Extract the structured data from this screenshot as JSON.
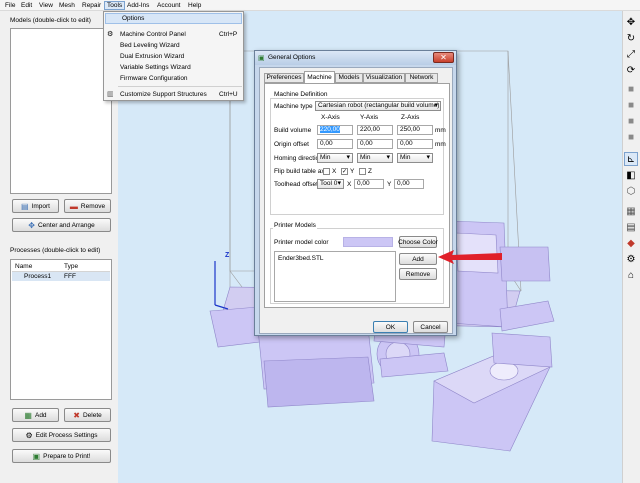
{
  "menubar": {
    "file": "File",
    "edit": "Edit",
    "view": "View",
    "mesh": "Mesh",
    "repair": "Repair",
    "tools": "Tools",
    "addins": "Add-Ins",
    "account": "Account",
    "help": "Help"
  },
  "tools_menu": {
    "options": "Options",
    "machine_control": "Machine Control Panel",
    "machine_control_shortcut": "Ctrl+P",
    "bed_leveling": "Bed Leveling Wizard",
    "dual_extrusion": "Dual Extrusion Wizard",
    "variable_settings": "Variable Settings Wizard",
    "firmware": "Firmware Configuration",
    "support": "Customize Support Structures",
    "support_shortcut": "Ctrl+U"
  },
  "left": {
    "models_title": "Models (double-click to edit)",
    "import": "Import",
    "remove": "Remove",
    "center": "Center and Arrange",
    "processes_title": "Processes (double-click to edit)",
    "col_name": "Name",
    "col_type": "Type",
    "process_name": "Process1",
    "process_type": "FFF",
    "add": "Add",
    "delete": "Delete",
    "edit_process": "Edit Process Settings",
    "prepare": "Prepare to Print!"
  },
  "viewport": {
    "axis_z": "Z"
  },
  "dialog": {
    "title": "General Options",
    "tabs": [
      "Preferences",
      "Machine",
      "Models",
      "Visualization",
      "Network"
    ],
    "machine_def": "Machine Definition",
    "machine_type_label": "Machine type",
    "machine_type_value": "Cartesian robot (rectangular build volume)",
    "x_axis": "X-Axis",
    "y_axis": "Y-Axis",
    "z_axis": "Z-Axis",
    "build_volume": "Build volume",
    "bv_x": "220,00",
    "bv_y": "220,00",
    "bv_z": "250,00",
    "origin_offset": "Origin offset",
    "oo_x": "0,00",
    "oo_y": "0,00",
    "oo_z": "0,00",
    "mm": "mm",
    "homing": "Homing direction",
    "home_x": "Min",
    "home_y": "Min",
    "home_z": "Min",
    "flip": "Flip build table axis",
    "flip_x": "X",
    "flip_y": "Y",
    "flip_z": "Z",
    "toolhead": "Toolhead offsets",
    "tool_sel": "Tool 0",
    "th_x_label": "X",
    "th_x": "0,00",
    "th_y_label": "Y",
    "th_y": "0,00",
    "printer_models": "Printer Models",
    "model_color": "Printer model color",
    "choose_color": "Choose Color",
    "model_file": "Ender3bed.STL",
    "add": "Add",
    "remove": "Remove",
    "ok": "OK",
    "cancel": "Cancel"
  },
  "colors": {
    "model": "#ccc6f5",
    "model_edge": "#8f86c9",
    "viewport": "#d6e9f8",
    "accent": "#3399ff",
    "arrow": "#e0202a"
  }
}
